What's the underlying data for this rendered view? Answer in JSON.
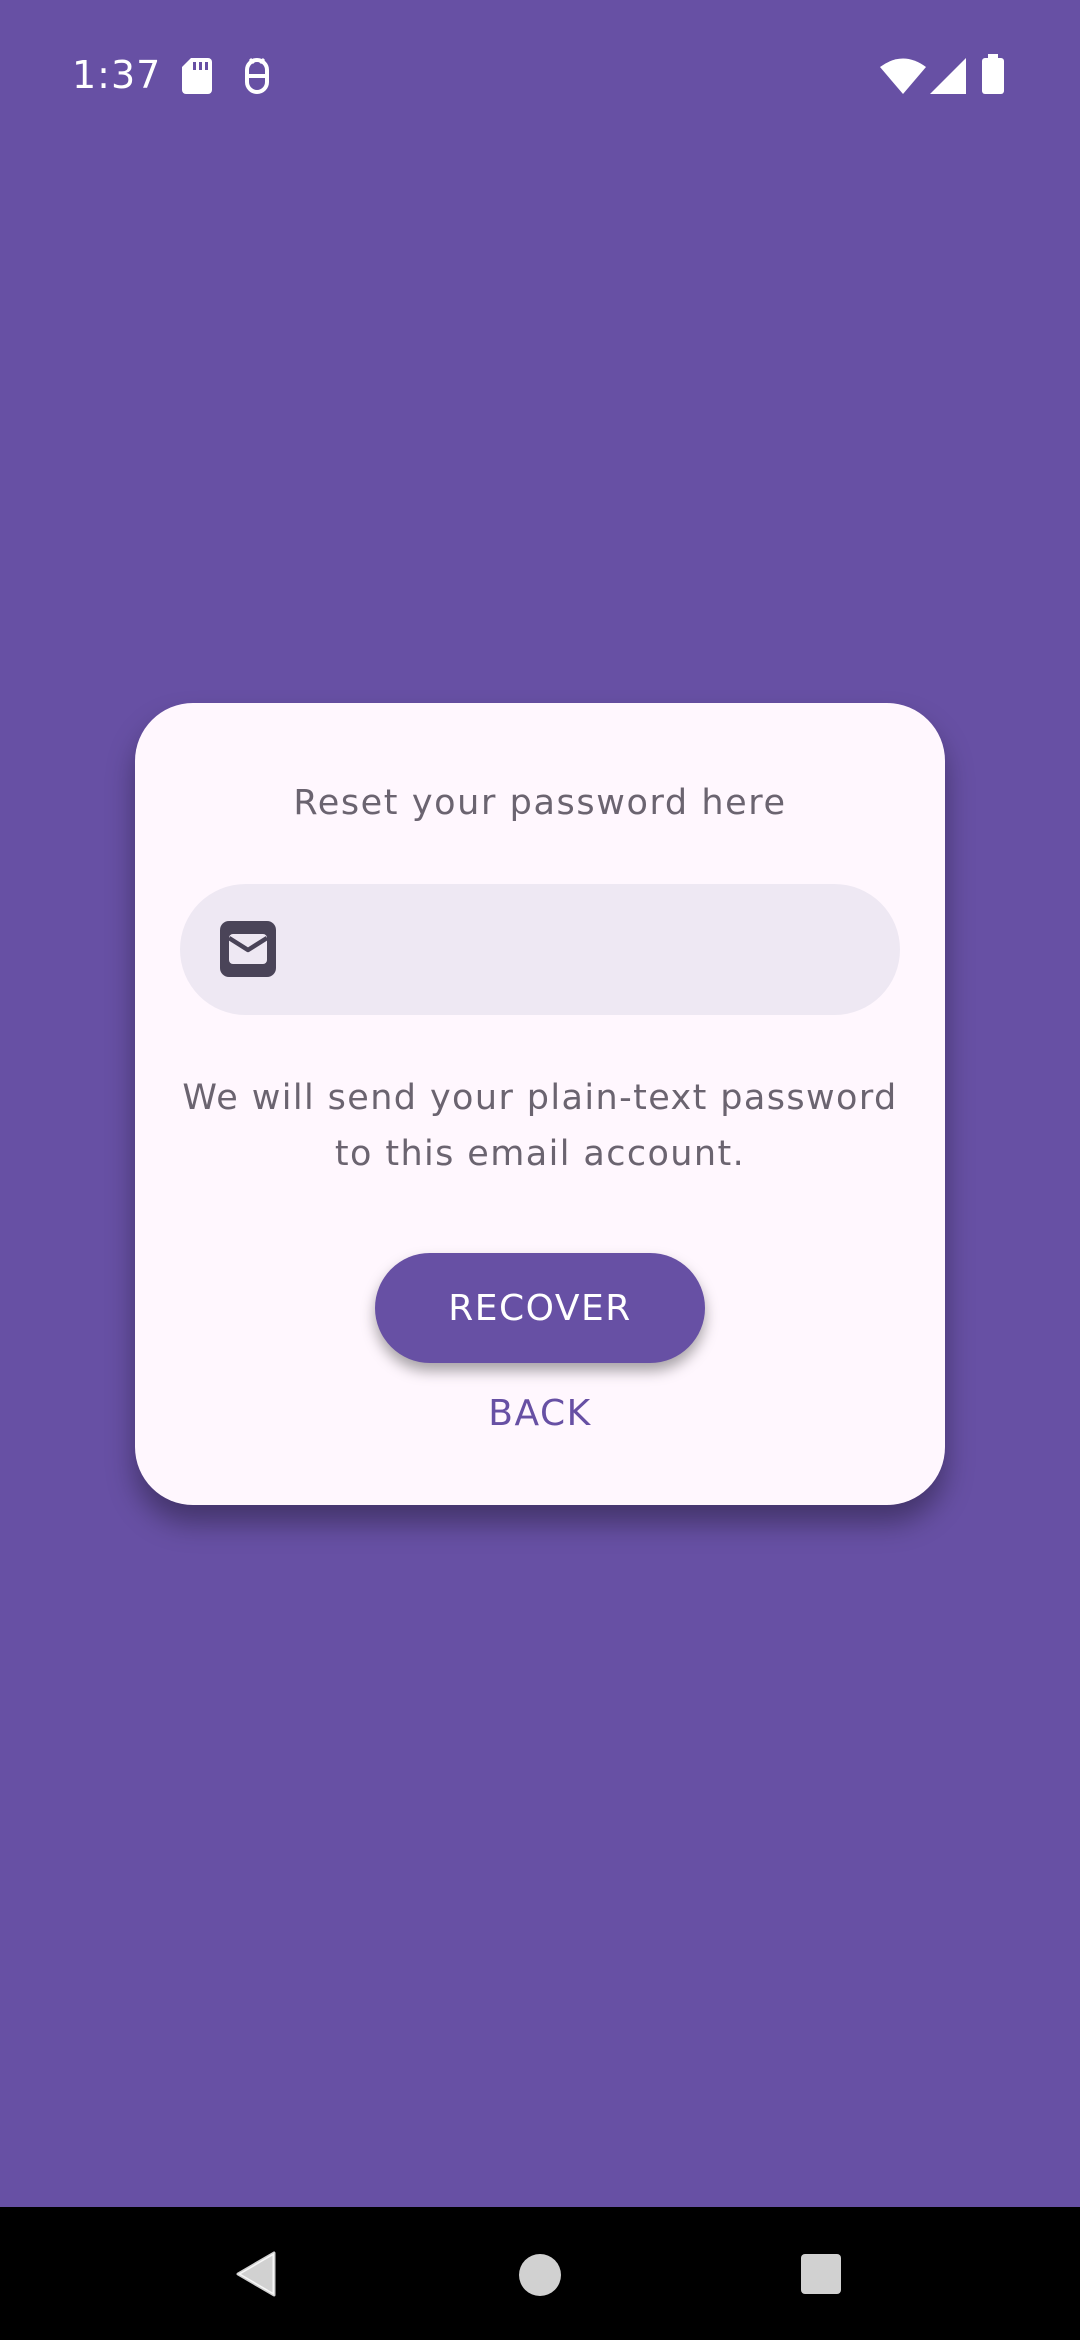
{
  "status_bar": {
    "time": "1:37",
    "icons": [
      "sd-card-icon",
      "debug-icon",
      "wifi-icon",
      "cell-signal-icon",
      "battery-icon"
    ]
  },
  "reset_card": {
    "title": "Reset your password here",
    "email_field": {
      "value": "",
      "placeholder": "",
      "icon": "mail-icon"
    },
    "helper_text": "We will send your plain-text password to this email account.",
    "recover_label": "RECOVER",
    "back_label": "BACK"
  },
  "nav_bar": {
    "buttons": [
      "back-icon",
      "home-icon",
      "recents-icon"
    ]
  },
  "colors": {
    "background": "#6750A4",
    "card": "#FFF7FE",
    "field": "#EEE8F3",
    "primary": "#6750A4",
    "muted_text": "#6B6470",
    "nav_bar": "#000000"
  }
}
